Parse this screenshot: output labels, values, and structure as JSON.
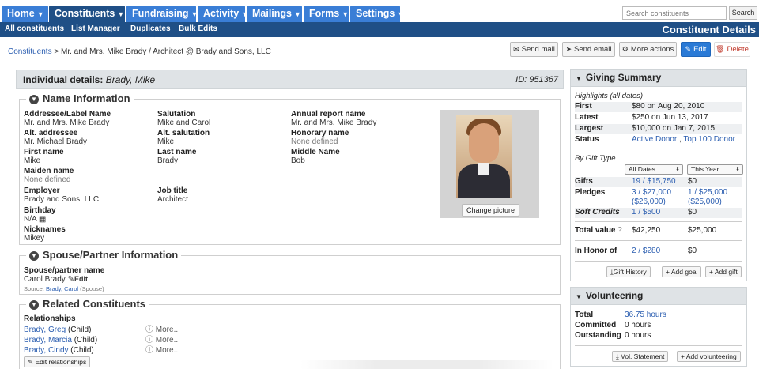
{
  "nav": {
    "tabs": [
      "Home",
      "Constituents",
      "Fundraising",
      "Activity",
      "Mailings",
      "Forms",
      "Settings"
    ],
    "search_placeholder": "Search constituents",
    "search_button": "Search"
  },
  "subnav": {
    "items": [
      "All constituents",
      "List Manager",
      "Duplicates",
      "Bulk Edits"
    ],
    "title": "Constituent Details"
  },
  "breadcrumb": {
    "root": "Constituents",
    "rest": " > Mr. and Mrs. Mike Brady / Architect @ Brady and Sons, LLC"
  },
  "actions": {
    "send_mail": "Send mail",
    "send_email": "Send email",
    "more_actions": "More actions",
    "edit": "Edit",
    "delete": "Delete"
  },
  "details": {
    "heading": "Individual details:",
    "name": "Brady, Mike",
    "id": "ID: 951367"
  },
  "name_info": {
    "legend": "Name Information",
    "addressee_label": "Addressee/Label Name",
    "addressee": "Mr. and Mrs. Mike Brady",
    "salutation_label": "Salutation",
    "salutation": "Mike and Carol",
    "annual_label": "Annual report name",
    "annual": "Mr. and Mrs. Mike Brady",
    "alt_addressee_label": "Alt. addressee",
    "alt_addressee": "Mr. Michael Brady",
    "alt_salutation_label": "Alt. salutation",
    "alt_salutation": "Mike",
    "honorary_label": "Honorary name",
    "honorary": "None defined",
    "first_label": "First name",
    "first": "Mike",
    "last_label": "Last name",
    "last": "Brady",
    "middle_label": "Middle Name",
    "middle": "Bob",
    "maiden_label": "Maiden name",
    "maiden": "None defined",
    "employer_label": "Employer",
    "employer": "Brady and Sons, LLC",
    "job_label": "Job title",
    "job": "Architect",
    "birthday_label": "Birthday",
    "birthday": "N/A",
    "nicknames_label": "Nicknames",
    "nicknames": "Mikey",
    "change_picture": "Change picture"
  },
  "spouse": {
    "legend": "Spouse/Partner Information",
    "label": "Spouse/partner name",
    "name": "Carol Brady",
    "edit": "Edit",
    "source_prefix": "Source: ",
    "source_link": "Brady, Carol",
    "source_suffix": " (Spouse)"
  },
  "related": {
    "legend": "Related Constituents",
    "label": "Relationships",
    "items": [
      {
        "name": "Brady, Greg",
        "rel": " (Child)",
        "more": "More..."
      },
      {
        "name": "Brady, Marcia",
        "rel": " (Child)",
        "more": "More..."
      },
      {
        "name": "Brady, Cindy",
        "rel": " (Child)",
        "more": "More..."
      }
    ],
    "edit_button": "Edit relationships"
  },
  "giving": {
    "title": "Giving Summary",
    "highlights": "Highlights (all dates)",
    "first_k": "First",
    "first_v": "$80 on Aug 20, 2010",
    "latest_k": "Latest",
    "latest_v": "$250 on Jun 13, 2017",
    "largest_k": "Largest",
    "largest_v": "$10,000 on Jan 7, 2015",
    "status_k": "Status",
    "status_v1": "Active Donor",
    "status_sep": " , ",
    "status_v2": "Top 100 Donor",
    "by_type": "By Gift Type",
    "sel1": "All Dates",
    "sel2": "This Year",
    "gifts_k": "Gifts",
    "gifts_v": "19 / $15,750",
    "gifts_v2": "$0",
    "pledges_k": "Pledges",
    "pledges_v": "3 / $27,000",
    "pledges_v_b": "($26,000)",
    "pledges_v2": "1 / $25,000",
    "pledges_v2_b": "($25,000)",
    "soft_k": "Soft Credits",
    "soft_v": "1 / $500",
    "soft_v2": "$0",
    "total_k": "Total value",
    "total_v": "$42,250",
    "total_v2": "$25,000",
    "honor_k": "In Honor of",
    "honor_v": "2 / $280",
    "honor_v2": "$0",
    "gift_history": "Gift History",
    "add_goal": "Add goal",
    "add_gift": "Add gift"
  },
  "volunteering": {
    "title": "Volunteering",
    "total_k": "Total",
    "total_v": "36.75 hours",
    "committed_k": "Committed",
    "committed_v": "0 hours",
    "outstanding_k": "Outstanding",
    "outstanding_v": "0 hours",
    "vol_statement": "Vol. Statement",
    "add_volunteering": "Add volunteering"
  }
}
